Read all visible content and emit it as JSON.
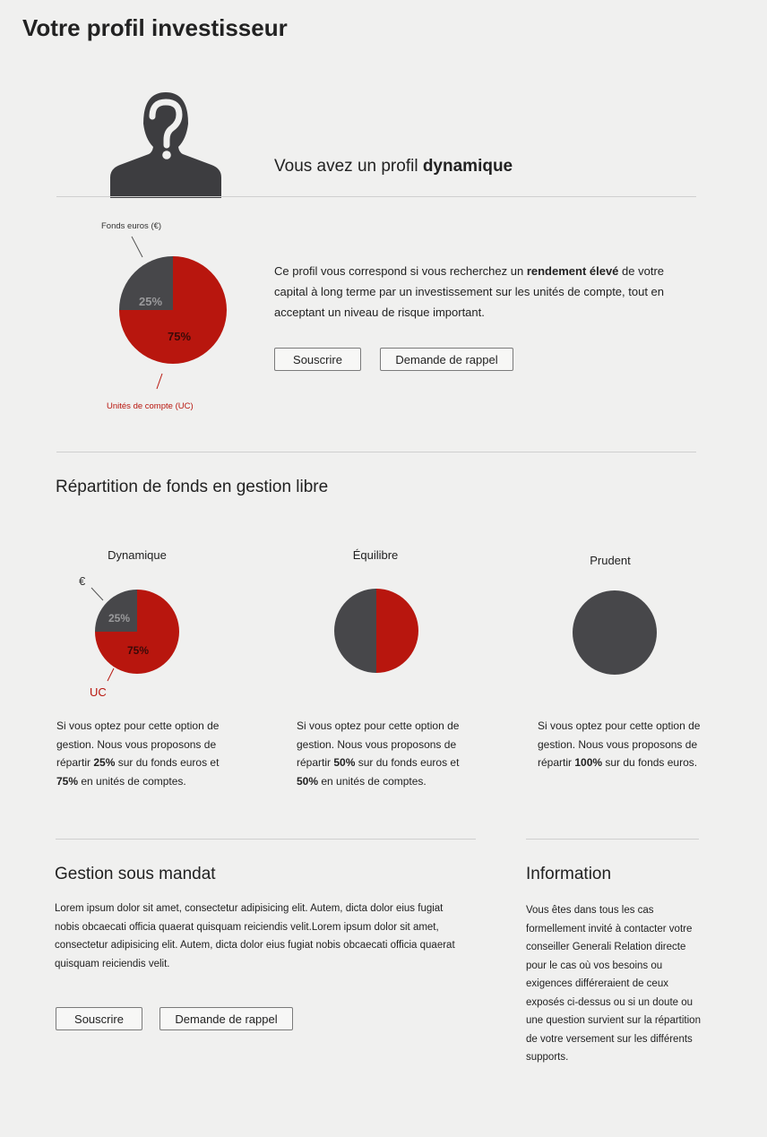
{
  "page": {
    "title": "Votre profil investisseur"
  },
  "profile": {
    "heading_prefix": "Vous avez un profil ",
    "heading_strong": "dynamique",
    "desc_1": "Ce profil vous correspond si vous recherchez un ",
    "desc_strong": "rendement élevé",
    "desc_2": " de votre capital à long terme par un investissement sur les unités de compte, tout en acceptant un niveau de risque important.",
    "subscribe_label": "Souscrire",
    "callback_label": "Demande de rappel",
    "icon": "person-question-icon"
  },
  "colors": {
    "red": "#b8160e",
    "dark": "#47474a",
    "background": "#f0f0ef"
  },
  "main_chart": {
    "label_euros": "Fonds euros (€)",
    "label_uc": "Unités de compte (UC)",
    "pct_euros": "25%",
    "pct_uc": "75%"
  },
  "repartition": {
    "title": "Répartition de fonds en gestion libre",
    "columns": [
      {
        "title": "Dynamique",
        "label_euros": "€",
        "label_uc": "UC",
        "pct_euros": "25%",
        "pct_uc": "75%",
        "text_1": "Si vous optez pour cette option de gestion. Nous vous proposons de répartir ",
        "strong_1": "25%",
        "text_2": " sur du fonds euros et ",
        "strong_2": "75%",
        "text_3": " en unités de comptes."
      },
      {
        "title": "Équilibre",
        "text_1": "Si vous optez pour cette option de gestion. Nous vous proposons de répartir ",
        "strong_1": "50%",
        "text_2": " sur du fonds euros et ",
        "strong_2": "50%",
        "text_3": " en unités de comptes."
      },
      {
        "title": "Prudent",
        "text_1": "Si vous optez pour cette option de gestion. Nous vous proposons de répartir ",
        "strong_1": "100%",
        "text_2": " sur du fonds euros."
      }
    ]
  },
  "chart_data": [
    {
      "type": "pie",
      "categories": [
        "Fonds euros (€)",
        "Unités de compte (UC)"
      ],
      "values": [
        25,
        75
      ],
      "colors": [
        "#47474a",
        "#b8160e"
      ]
    },
    {
      "type": "pie",
      "title": "Dynamique",
      "categories": [
        "€",
        "UC"
      ],
      "values": [
        25,
        75
      ],
      "colors": [
        "#47474a",
        "#b8160e"
      ]
    },
    {
      "type": "pie",
      "title": "Équilibre",
      "values": [
        50,
        50
      ],
      "colors": [
        "#47474a",
        "#b8160e"
      ]
    },
    {
      "type": "pie",
      "title": "Prudent",
      "values": [
        100,
        0
      ],
      "colors": [
        "#47474a",
        "#b8160e"
      ]
    }
  ],
  "mandat": {
    "title": "Gestion sous mandat",
    "text": "Lorem ipsum dolor sit amet, consectetur adipisicing elit. Autem, dicta dolor eius fugiat nobis obcaecati officia quaerat quisquam reiciendis velit.Lorem ipsum dolor sit amet, consectetur adipisicing elit. Autem, dicta dolor eius fugiat nobis obcaecati officia quaerat quisquam reiciendis velit.",
    "subscribe_label": "Souscrire",
    "callback_label": "Demande de rappel"
  },
  "information": {
    "title": "Information",
    "text": "Vous êtes dans tous les cas formellement invité à contacter votre conseiller Generali Relation directe pour le cas où vos besoins ou exigences différeraient de ceux exposés ci-dessus ou si un doute ou une question survient sur la répartition de votre versement sur les différents supports."
  }
}
